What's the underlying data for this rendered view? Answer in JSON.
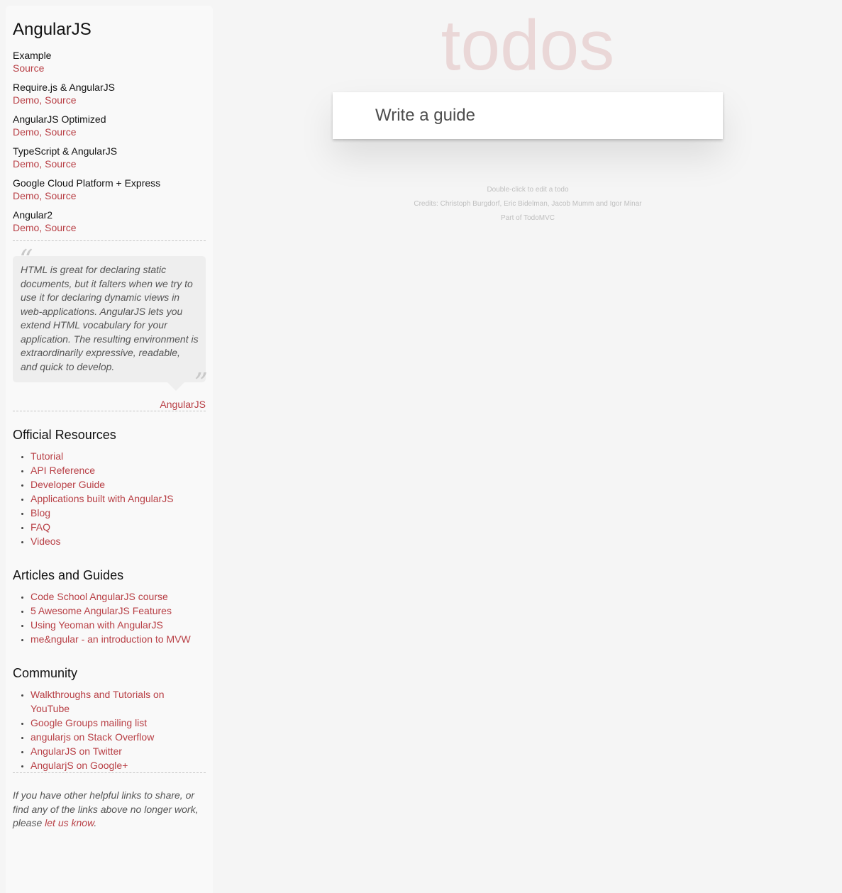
{
  "sidebar": {
    "title": "AngularJS",
    "examples": [
      {
        "name": "Example",
        "links": [
          "Source"
        ]
      },
      {
        "name": "Require.js & AngularJS",
        "links": [
          "Demo",
          "Source"
        ]
      },
      {
        "name": "AngularJS Optimized",
        "links": [
          "Demo",
          "Source"
        ]
      },
      {
        "name": "TypeScript & AngularJS",
        "links": [
          "Demo",
          "Source"
        ]
      },
      {
        "name": "Google Cloud Platform + Express",
        "links": [
          "Demo",
          "Source"
        ]
      },
      {
        "name": "Angular2",
        "links": [
          "Demo",
          "Source"
        ]
      }
    ],
    "link_separator": ", ",
    "quote": {
      "text": "HTML is great for declaring static documents, but it falters when we try to use it for declaring dynamic views in web-applications. AngularJS lets you extend HTML vocabulary for your application. The resulting environment is extraordinarily expressive, readable, and quick to develop.",
      "source": "AngularJS"
    },
    "sections": [
      {
        "title": "Official Resources",
        "links": [
          "Tutorial",
          "API Reference",
          "Developer Guide",
          "Applications built with AngularJS",
          "Blog",
          "FAQ",
          "Videos"
        ]
      },
      {
        "title": "Articles and Guides",
        "links": [
          "Code School AngularJS course",
          "5 Awesome AngularJS Features",
          "Using Yeoman with AngularJS",
          "me&ngular - an introduction to MVW"
        ]
      },
      {
        "title": "Community",
        "links": [
          "Walkthroughs and Tutorials on YouTube",
          "Google Groups mailing list",
          "angularjs on Stack Overflow",
          "AngularJS on Twitter",
          "AngularjS on Google+"
        ]
      }
    ],
    "footer": {
      "text_before": "If you have other helpful links to share, or find any of the links above no longer work, please ",
      "link": "let us know",
      "text_after": "."
    }
  },
  "main": {
    "title": "todos",
    "new_todo_value": "Write a guide",
    "info": {
      "edit_hint": "Double-click to edit a todo",
      "credits": "Credits: Christoph Burgdorf, Eric Bidelman, Jacob Mumm and Igor Minar",
      "part_of_prefix": "Part of ",
      "part_of_link": "TodoMVC"
    }
  },
  "colors": {
    "accent": "#b83f45",
    "background": "#f5f5f5",
    "sidebar_background": "#f9f9f9",
    "title": "rgba(175,47,47,0.15)"
  }
}
